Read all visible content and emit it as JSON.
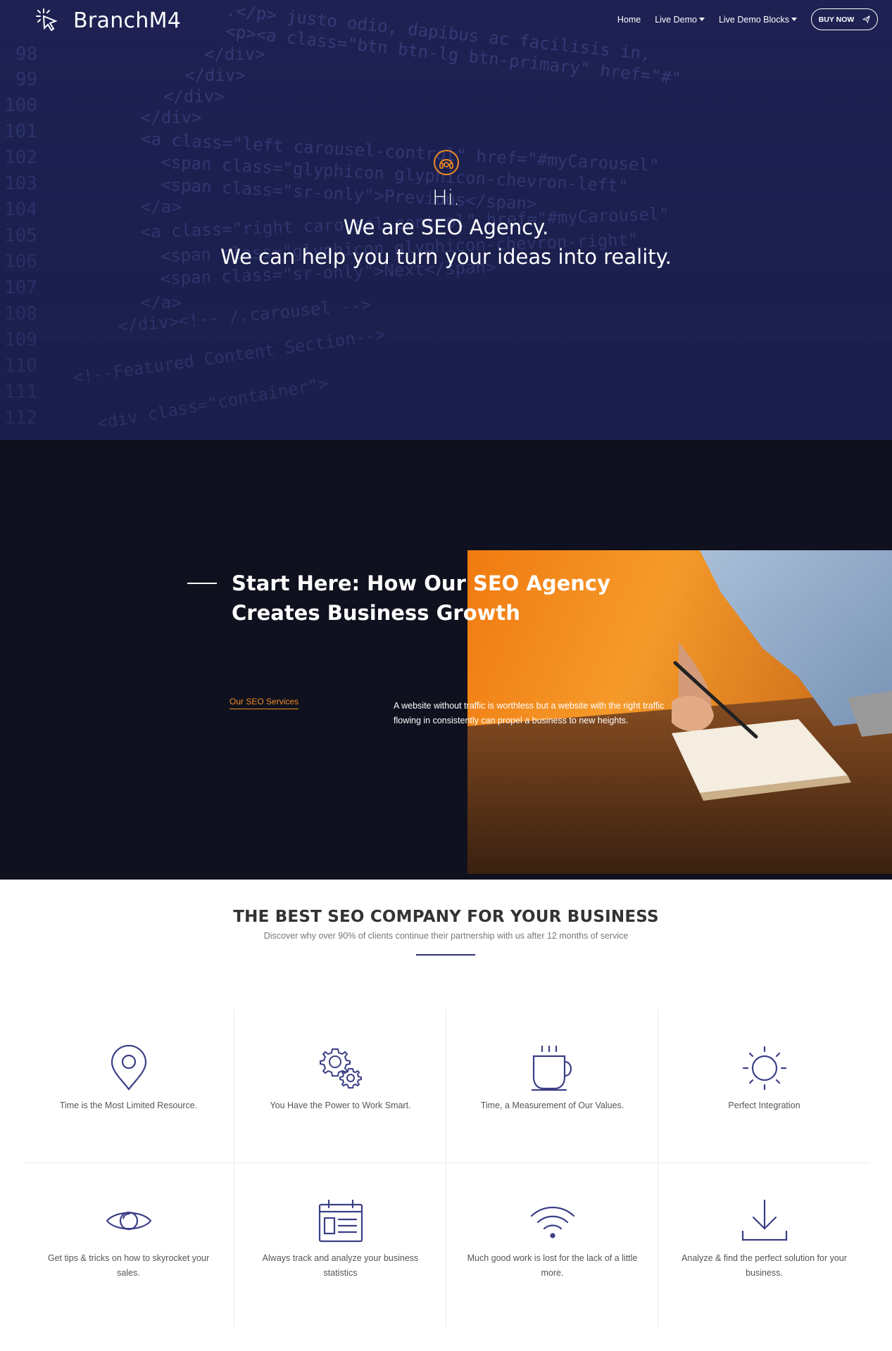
{
  "nav": {
    "brand": "BranchM4",
    "items": [
      {
        "label": "Home",
        "dropdown": false
      },
      {
        "label": "Live Demo",
        "dropdown": true
      },
      {
        "label": "Live Demo Blocks",
        "dropdown": true
      }
    ],
    "buy_label": "BUY NOW"
  },
  "hero": {
    "icon": "headset-icon",
    "hi": "Hi.",
    "line1": "We are SEO Agency.",
    "line2": "We can help you turn your ideas into reality."
  },
  "intro": {
    "title": "Start Here: How Our SEO Agency Creates Business Growth",
    "link": "Our SEO Services",
    "text": "A website without traffic is worthless but a website with the right traffic flowing in consistently can propel a business to new heights."
  },
  "features": {
    "title": "THE BEST SEO COMPANY FOR YOUR BUSINESS",
    "subtitle": "Discover why over 90% of clients continue their partnership with us after 12 months of service",
    "items": [
      {
        "icon": "map-pin-icon",
        "caption": "Time is the Most Limited Resource."
      },
      {
        "icon": "gears-icon",
        "caption": "You Have the Power to Work Smart."
      },
      {
        "icon": "coffee-cup-icon",
        "caption": "Time, a Measurement of Our Values."
      },
      {
        "icon": "sun-icon",
        "caption": "Perfect Integration"
      },
      {
        "icon": "eye-icon",
        "caption": "Get tips & tricks on how to skyrocket your sales."
      },
      {
        "icon": "clipboard-icon",
        "caption": "Always track and analyze your business statistics"
      },
      {
        "icon": "wifi-icon",
        "caption": "Much good work is lost for the lack of a little more."
      },
      {
        "icon": "download-icon",
        "caption": "Analyze & find the perfect solution for your business."
      }
    ]
  },
  "colors": {
    "hero_bg": "#1f2350",
    "dark_bg": "#10111e",
    "accent": "#f08a24",
    "icon_stroke": "#3b3f86"
  }
}
